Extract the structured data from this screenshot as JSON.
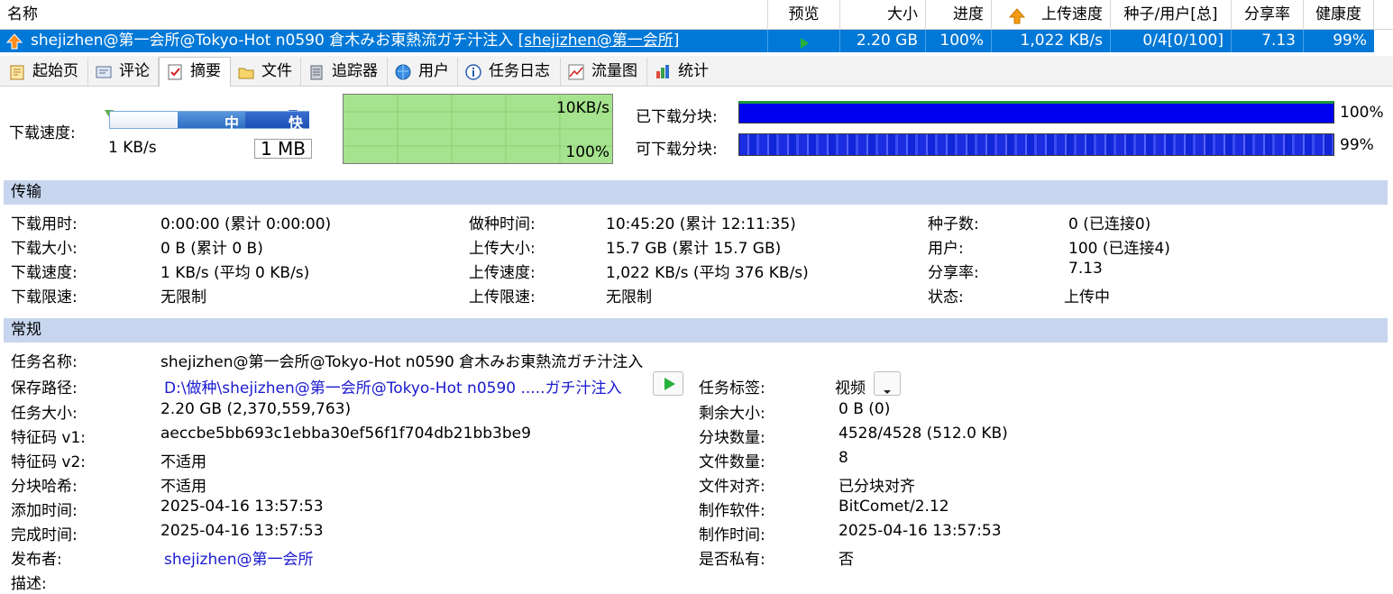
{
  "columns": {
    "name": "名称",
    "preview": "预览",
    "size": "大小",
    "progress": "进度",
    "upload_speed": "上传速度",
    "peers": "种子/用户[总]",
    "ratio": "分享率",
    "health": "健康度"
  },
  "task": {
    "name_main": "shejizhen@第一会所@Tokyo-Hot n0590 倉木みお東熱流ガチ汁注入 ",
    "name_tag": "[shejizhen@第一会所]",
    "size": "2.20 GB",
    "progress": "100%",
    "upload_speed": "1,022 KB/s",
    "peers": "0/4[0/100]",
    "ratio": "7.13",
    "health": "99%"
  },
  "tabs": [
    {
      "label": "起始页",
      "icon": "home-page-icon"
    },
    {
      "label": "评论",
      "icon": "comment-icon"
    },
    {
      "label": "摘要",
      "icon": "summary-icon"
    },
    {
      "label": "文件",
      "icon": "file-icon"
    },
    {
      "label": "追踪器",
      "icon": "tracker-icon"
    },
    {
      "label": "用户",
      "icon": "users-icon"
    },
    {
      "label": "任务日志",
      "icon": "info-icon"
    },
    {
      "label": "流量图",
      "icon": "chart-icon"
    },
    {
      "label": "统计",
      "icon": "stats-icon"
    }
  ],
  "speed": {
    "label": "下载速度:",
    "slider_mid": "中",
    "slider_fast": "快",
    "current": "1 KB/s",
    "limit": "1 MB",
    "graph_max": "10KB/s",
    "graph_pct": "100%"
  },
  "pieces": {
    "downloaded_label": "已下载分块:",
    "downloaded_pct": "100%",
    "available_label": "可下载分块:",
    "available_pct": "99%"
  },
  "transfer": {
    "title": "传输",
    "dl_time_label": "下载用时:",
    "dl_time": "0:00:00 (累计 0:00:00)",
    "dl_size_label": "下载大小:",
    "dl_size": "0 B (累计 0 B)",
    "dl_speed_label": "下载速度:",
    "dl_speed": "1 KB/s (平均 0 KB/s)",
    "dl_limit_label": "下载限速:",
    "dl_limit": "无限制",
    "seed_time_label": "做种时间:",
    "seed_time": "10:45:20 (累计 12:11:35)",
    "ul_size_label": "上传大小:",
    "ul_size": "15.7 GB (累计 15.7 GB)",
    "ul_speed_label": "上传速度:",
    "ul_speed": "1,022 KB/s (平均 376 KB/s)",
    "ul_limit_label": "上传限速:",
    "ul_limit": "无限制",
    "seeds_label": "种子数:",
    "seeds": "0 (已连接0)",
    "users_label": "用户:",
    "users": "100 (已连接4)",
    "ratio_label": "分享率:",
    "ratio": "7.13",
    "status_label": "状态:",
    "status": "上传中"
  },
  "general": {
    "title": "常规",
    "name_label": "任务名称:",
    "name": "shejizhen@第一会所@Tokyo-Hot n0590 倉木みお東熱流ガチ汁注入",
    "path_label": "保存路径:",
    "path": "D:\\做种\\shejizhen@第一会所@Tokyo-Hot n0590 .....ガチ汁注入",
    "size_label": "任务大小:",
    "size": "2.20 GB (2,370,559,763)",
    "hash1_label": "特征码 v1:",
    "hash1": "aeccbe5bb693c1ebba30ef56f1f704db21bb3be9",
    "hash2_label": "特征码 v2:",
    "hash2": "不适用",
    "piece_hash_label": "分块哈希:",
    "piece_hash": "不适用",
    "added_label": "添加时间:",
    "added": "2025-04-16 13:57:53",
    "completed_label": "完成时间:",
    "completed": "2025-04-16 13:57:53",
    "publisher_label": "发布者:",
    "publisher": "shejizhen@第一会所",
    "desc_label": "描述:",
    "tag_label": "任务标签:",
    "tag": "视频",
    "remaining_label": "剩余大小:",
    "remaining": "0 B (0)",
    "piece_count_label": "分块数量:",
    "piece_count": "4528/4528 (512.0 KB)",
    "file_count_label": "文件数量:",
    "file_count": "8",
    "align_label": "文件对齐:",
    "align": "已分块对齐",
    "software_label": "制作软件:",
    "software": "BitComet/2.12",
    "created_label": "制作时间:",
    "created": "2025-04-16 13:57:53",
    "private_label": "是否私有:",
    "private": "否"
  }
}
